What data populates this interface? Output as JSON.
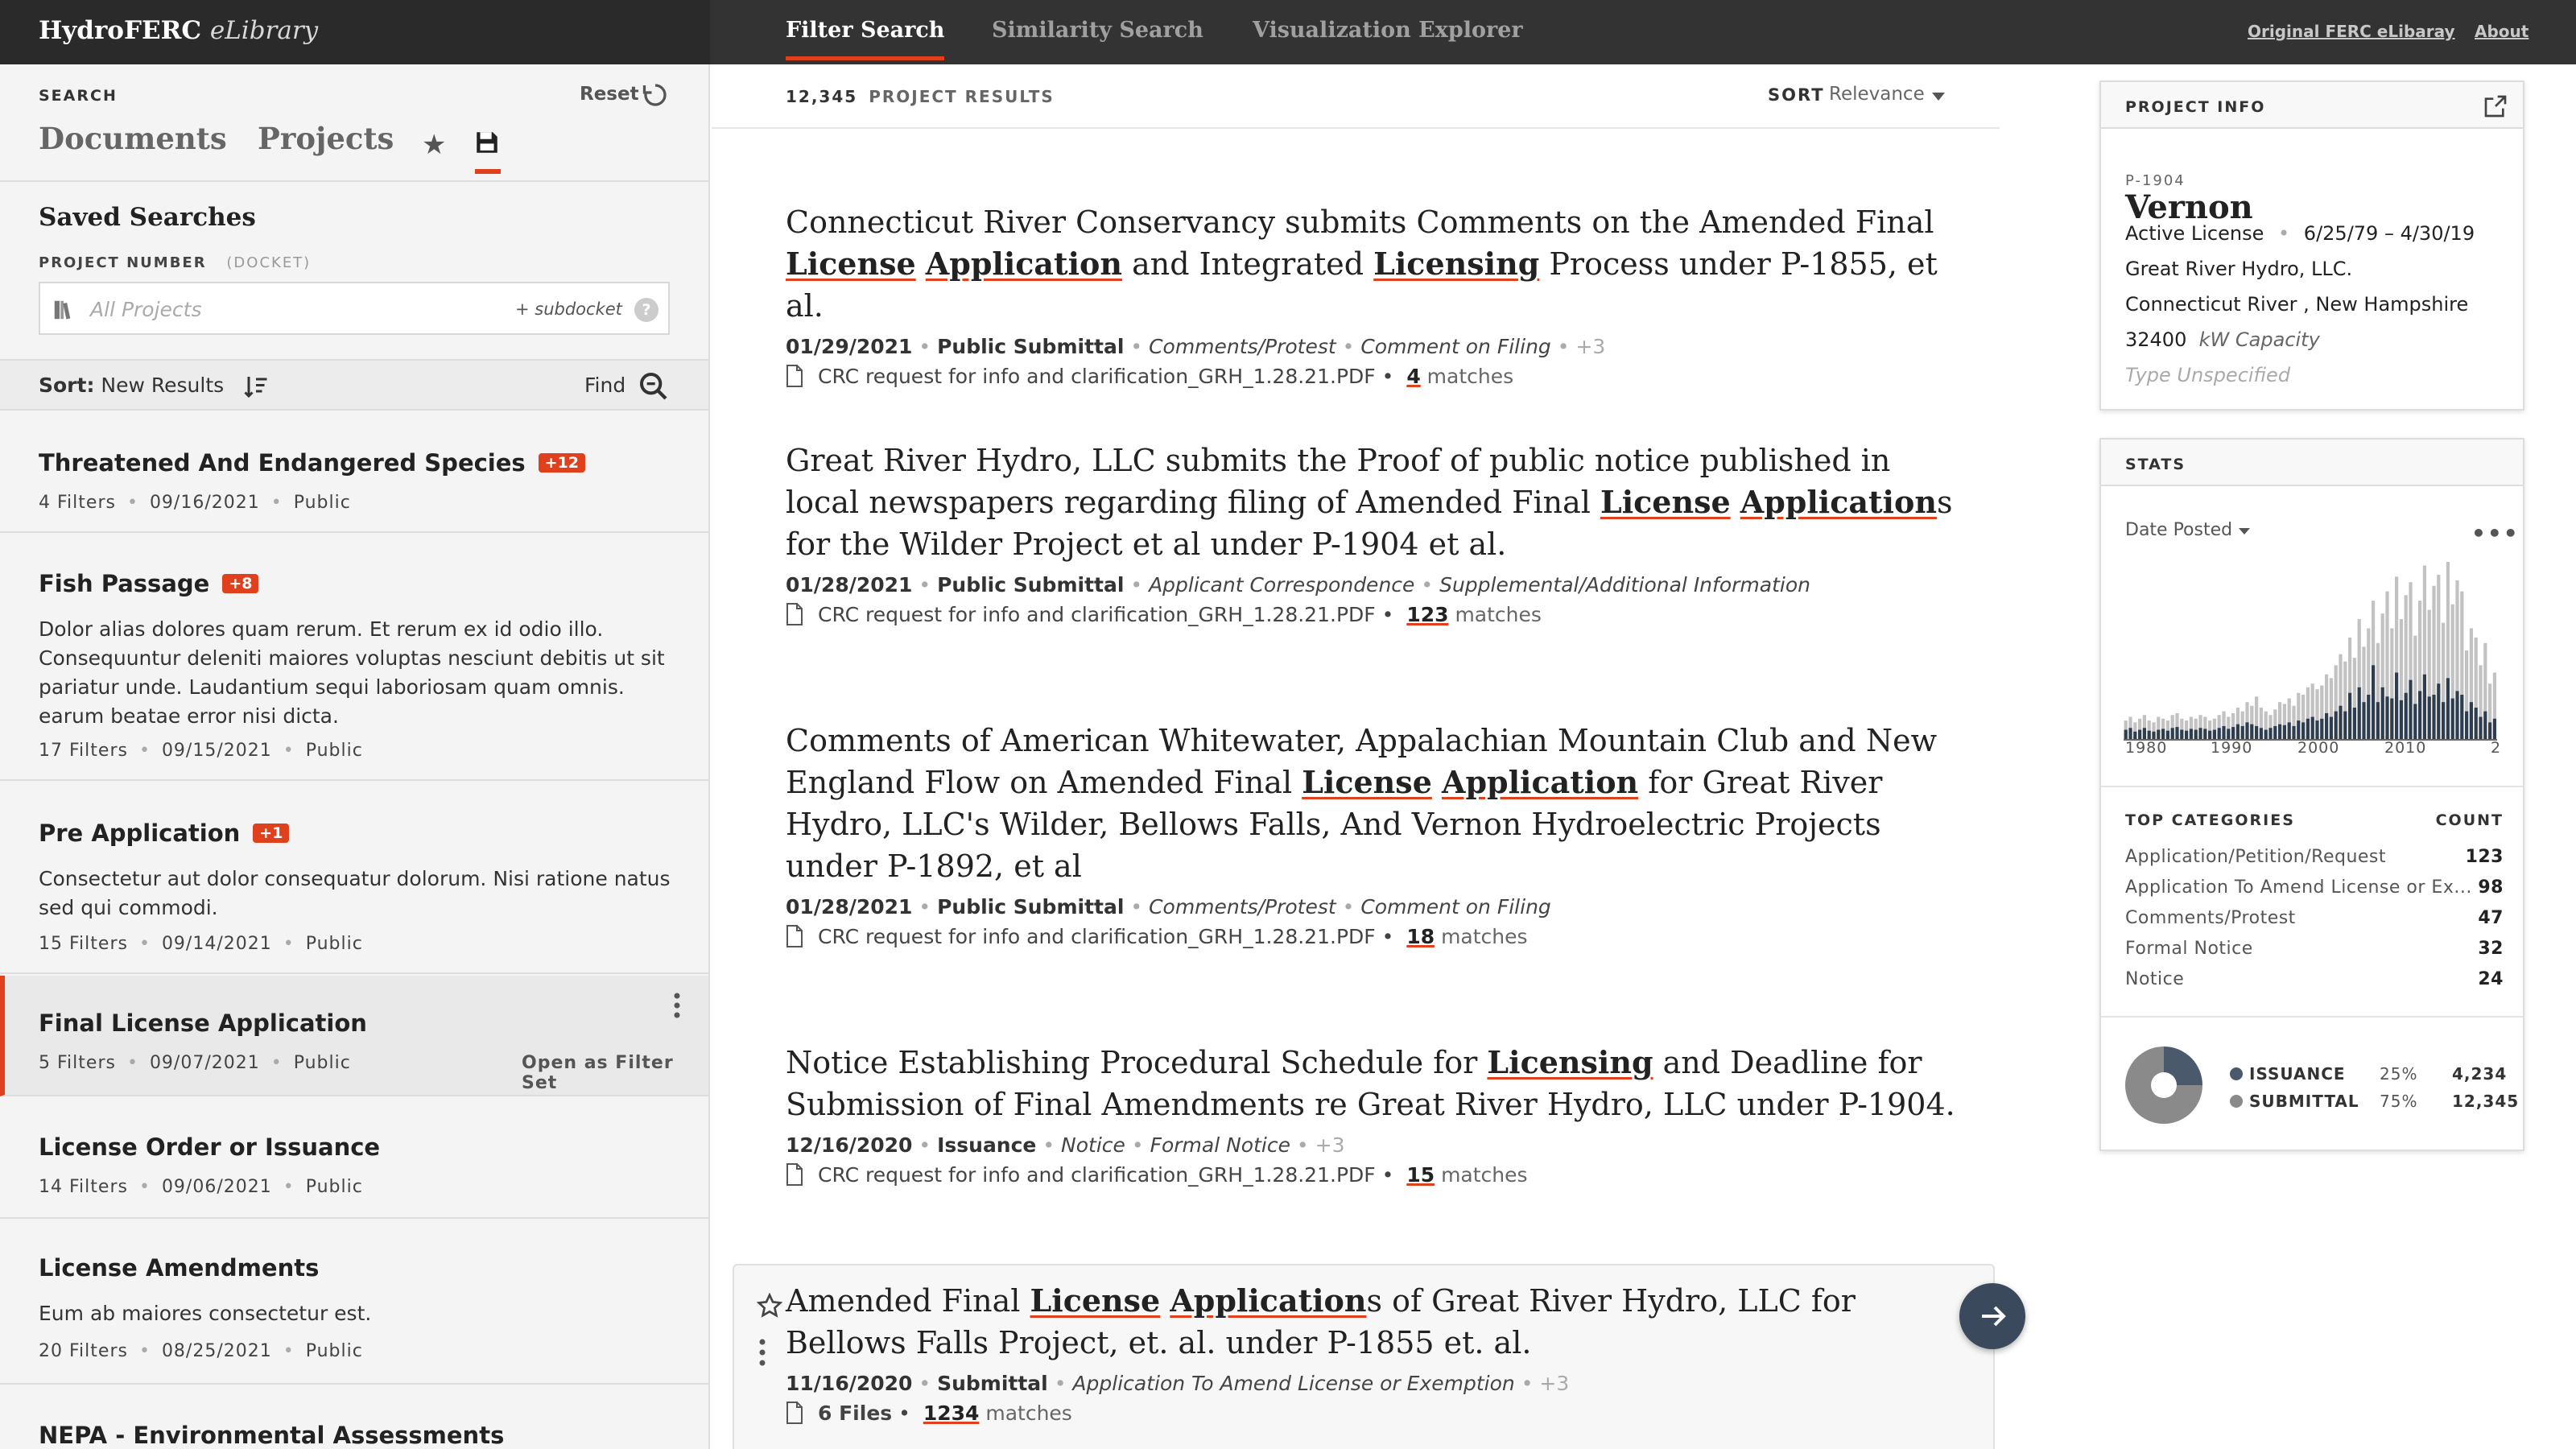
{
  "topbar": {
    "brand": "HydroFERC",
    "brand_sub": "eLibrary",
    "nav": [
      "Filter Search",
      "Similarity Search",
      "Visualization Explorer"
    ],
    "links": [
      "Original FERC eLibaray",
      "About"
    ]
  },
  "sidebar": {
    "search_label": "SEARCH",
    "reset_label": "Reset",
    "tabs": [
      "Documents",
      "Projects"
    ],
    "saved_title": "Saved Searches",
    "project_number_label": "PROJECT NUMBER",
    "docket_label": "(DOCKET)",
    "project_placeholder": "All Projects",
    "subdocket_label": "+ subdocket",
    "help_label": "?",
    "sort_label": "Sort:",
    "sort_value": "New Results",
    "find_label": "Find",
    "items": [
      {
        "title": "Threatened And Endangered Species",
        "badge": "+12",
        "desc": "",
        "filters": "4",
        "filters_word": "Filters",
        "date": "09/16/2021",
        "visibility": "Public"
      },
      {
        "title": "Fish Passage",
        "badge": "+8",
        "desc": "Dolor alias dolores quam rerum. Et rerum ex id odio illo. Consequuntur deleniti maiores voluptas nesciunt debitis ut sit pariatur unde. Laudantium sequi laboriosam quam omnis. earum beatae error nisi dicta.",
        "filters": "17",
        "filters_word": "Filters",
        "date": "09/15/2021",
        "visibility": "Public"
      },
      {
        "title": "Pre Application",
        "badge": "+1",
        "desc": "Consectetur aut dolor consequatur dolorum. Nisi ratione natus sed qui commodi.",
        "filters": "15",
        "filters_word": "Filters",
        "date": "09/14/2021",
        "visibility": "Public"
      },
      {
        "title": "Final License Application",
        "badge": "",
        "desc": "",
        "filters": "5",
        "filters_word": "Filters",
        "date": "09/07/2021",
        "visibility": "Public",
        "action": "Open as Filter Set"
      },
      {
        "title": "License Order or Issuance",
        "badge": "",
        "desc": "",
        "filters": "14",
        "filters_word": "Filters",
        "date": "09/06/2021",
        "visibility": "Public"
      },
      {
        "title": "License Amendments",
        "badge": "",
        "desc": "Eum ab maiores consectetur est.",
        "filters": "20",
        "filters_word": "Filters",
        "date": "08/25/2021",
        "visibility": "Public"
      },
      {
        "title": "NEPA - Environmental Assessments",
        "badge": "",
        "desc": "",
        "filters": "",
        "filters_word": "",
        "date": "",
        "visibility": ""
      }
    ]
  },
  "results": {
    "count": "12,345",
    "count_label": "PROJECT RESULTS",
    "sort_label": "SORT",
    "sort_value": "Relevance",
    "file_name": "CRC request for info and clarification_GRH_1.28.21.PDF",
    "matches_word": "matches",
    "items": [
      {
        "date": "01/29/2021",
        "type": "Public Submittal",
        "cats": [
          "Comments/Protest",
          "Comment on Filing"
        ],
        "more": "+3",
        "matches": "4"
      },
      {
        "date": "01/28/2021",
        "type": "Public Submittal",
        "cats": [
          "Applicant Correspondence",
          "Supplemental/Additional Information"
        ],
        "more": "",
        "matches": "123"
      },
      {
        "date": "01/28/2021",
        "type": "Public Submittal",
        "cats": [
          "Comments/Protest",
          "Comment on Filing"
        ],
        "more": "",
        "matches": "18"
      },
      {
        "date": "12/16/2020",
        "type": "Issuance",
        "cats": [
          "Notice",
          "Formal Notice"
        ],
        "more": "+3",
        "matches": "15"
      },
      {
        "date": "11/16/2020",
        "type": "Submittal",
        "cats": [
          "Application To Amend License or Exemption"
        ],
        "more": "+3",
        "matches": "1234",
        "files": "6 Files"
      }
    ],
    "titles": [
      [
        "Connecticut River Conservancy submits Comments on the Amended Final ",
        "License",
        " ",
        "Application",
        " and Integrated ",
        "Licensing",
        " Process under P-1855, et al."
      ],
      [
        "Great River Hydro, LLC submits the Proof of public notice published in local newspapers regarding filing of Amended Final ",
        "License",
        " ",
        "Application",
        "s for the Wilder Project et al under P-1904 et al."
      ],
      [
        "Comments of American Whitewater, Appalachian Mountain Club and New England Flow on Amended Final ",
        "License",
        " ",
        "Application",
        " for Great River Hydro, LLC's Wilder, Bellows Falls, And Vernon Hydroelectric Projects under P-1892, et al"
      ],
      [
        "Notice Establishing Procedural Schedule for ",
        "Licensing",
        " and Deadline for Submission of Final Amendments re Great River Hydro, LLC under P-1904."
      ],
      [
        "Amended Final ",
        "License",
        " ",
        "Application",
        "s of Great River Hydro, LLC for Bellows Falls Project, et. al. under P-1855 et. al."
      ]
    ]
  },
  "project_info": {
    "label": "PROJECT INFO",
    "id": "P-1904",
    "name": "Vernon",
    "status": "Active License",
    "date_range": "6/25/79 – 4/30/19",
    "owner": "Great River Hydro, LLC.",
    "river": "Connecticut River",
    "state": "New Hampshire",
    "capacity": "32400",
    "capacity_unit": "kW Capacity",
    "type": "Type Unspecified"
  },
  "stats": {
    "label": "STATS",
    "date_posted": "Date Posted",
    "more": "•••",
    "top_categories_label": "TOP CATEGORIES",
    "count_label": "COUNT",
    "categories": [
      {
        "name": "Application/Petition/Request",
        "count": "123"
      },
      {
        "name": "Application To Amend License or Ex...",
        "count": "98"
      },
      {
        "name": "Comments/Protest",
        "count": "47"
      },
      {
        "name": "Formal Notice",
        "count": "32"
      },
      {
        "name": "Notice",
        "count": "24"
      }
    ],
    "legend": [
      {
        "name": "ISSUANCE",
        "pct": "25%",
        "count": "4,234",
        "color": "#4a5a6c"
      },
      {
        "name": "SUBMITTAL",
        "pct": "75%",
        "count": "12,345",
        "color": "#8a8a8a"
      }
    ]
  },
  "chart_data": [
    {
      "type": "bar",
      "x_ticks": [
        "1980",
        "1990",
        "2000",
        "2010",
        "2"
      ],
      "series": [
        {
          "values": [
            20,
            24,
            18,
            22,
            26,
            20,
            18,
            24,
            22,
            20,
            26,
            28,
            22,
            20,
            24,
            22,
            26,
            24,
            20,
            22,
            26,
            30,
            24,
            28,
            34,
            30,
            40,
            36,
            46,
            34,
            30,
            26,
            32,
            40,
            38,
            44,
            36,
            50,
            48,
            56,
            60,
            54,
            58,
            70,
            66,
            80,
            92,
            84,
            110,
            88,
            130,
            100,
            120,
            150,
            104,
            136,
            160,
            120,
            176,
            130,
            156,
            170,
            112,
            150,
            188,
            140,
            166,
            178,
            126,
            192,
            146,
            172,
            160,
            96,
            120,
            110,
            80,
            104,
            60,
            72
          ]
        },
        {
          "values": [
            10,
            12,
            8,
            10,
            12,
            9,
            8,
            10,
            11,
            9,
            12,
            13,
            10,
            9,
            11,
            10,
            12,
            11,
            9,
            10,
            12,
            14,
            11,
            13,
            16,
            14,
            18,
            16,
            14,
            12,
            10,
            12,
            14,
            16,
            15,
            18,
            14,
            20,
            18,
            22,
            24,
            20,
            22,
            28,
            24,
            30,
            36,
            30,
            50,
            34,
            56,
            40,
            48,
            80,
            40,
            56,
            46,
            44,
            72,
            42,
            50,
            64,
            38,
            52,
            70,
            46,
            48,
            60,
            40,
            66,
            44,
            52,
            48,
            30,
            40,
            34,
            24,
            30,
            18,
            22
          ]
        }
      ]
    },
    {
      "type": "pie",
      "categories": [
        "ISSUANCE",
        "SUBMITTAL"
      ],
      "values": [
        25,
        75
      ]
    }
  ]
}
